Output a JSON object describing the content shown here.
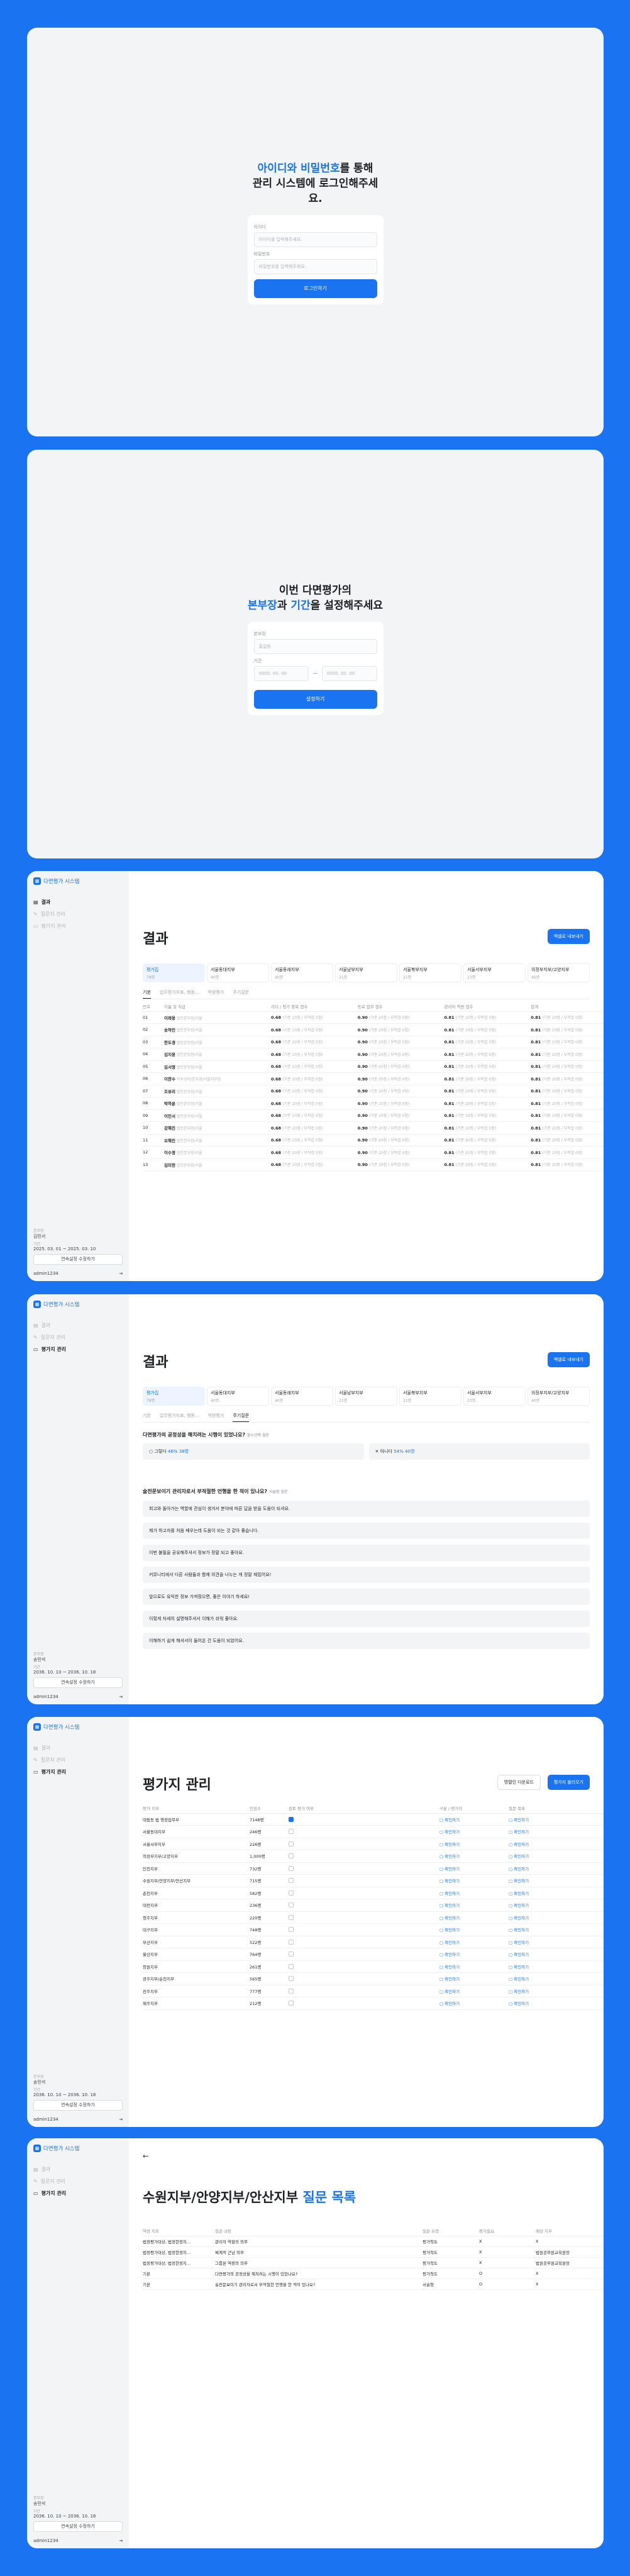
{
  "login": {
    "hero_a": "아이디와 ",
    "hero_b": "비밀번호",
    "hero_c": "를 통해",
    "hero_d": "관리 시스템에 로그인해주세요.",
    "id_label": "아이디",
    "id_placeholder": "아이디를 입력해주세요.",
    "pw_label": "비밀번호",
    "pw_placeholder": "비밀번호를 입력해주세요.",
    "button": "로그인하기"
  },
  "setup": {
    "hero_a": "이번 다면평가의",
    "hero_b": "본부장",
    "hero_c": "과 ",
    "hero_d": "기간",
    "hero_e": "을 설정해주세요",
    "name_label": "본부장",
    "name_placeholder": "홍길동",
    "period_label": "기간",
    "start_placeholder": "0000. 00. 00",
    "tilde": "~",
    "end_placeholder": "0000. 00. 00",
    "button": "설정하기"
  },
  "sidebar": {
    "brand": "다면평가 시스템",
    "nav": [
      "결과",
      "질문지 관리",
      "평가지 관리"
    ],
    "head_label": "본부장",
    "period_label": "기간",
    "button": "연속설정 수정하기",
    "user": "admin1234",
    "p3": {
      "head": "김민서",
      "period": "2025. 03. 01 ~ 2025. 03. 10"
    },
    "p4": {
      "head": "송민석",
      "period": "2036. 10. 10 ~ 2036. 10. 18"
    },
    "p5": {
      "head": "송민석",
      "period": "2036. 10. 10 ~ 2036. 10. 18"
    },
    "p6": {
      "head": "송민석",
      "period": "2036. 10. 10 ~ 2036. 10. 18"
    }
  },
  "result": {
    "title": "결과",
    "download": "엑셀로 내보내기",
    "tabs": [
      {
        "name": "평가집",
        "count": "78명"
      },
      {
        "name": "서울동대지부",
        "count": "40명"
      },
      {
        "name": "서울동래지부",
        "count": "40명"
      },
      {
        "name": "서울남부지부",
        "count": "21명"
      },
      {
        "name": "서울북부지부",
        "count": "21명"
      },
      {
        "name": "서울서부지부",
        "count": "23명"
      },
      {
        "name": "의정부지부/고양지부",
        "count": "40명"
      }
    ],
    "subtabs": [
      "기본",
      "업무평가지표, 행동...",
      "역량평가",
      "주기질문"
    ],
    "headers": [
      "번호",
      "이름 및 직급",
      "리더 / 평가 항목 점수",
      "동료 업무 점수",
      "관리자 역량 점수",
      "합계"
    ],
    "sub_a": "(기준 20점 / 부적합 0점)",
    "sub_b": "(기준 20점 / 부적합 0점)",
    "sub_c": "(기준 20점 / 부적합 0점)",
    "sub_d": "(기준 20점 / 부적합 0점)",
    "rows": [
      {
        "no": "01",
        "name": "이래웅",
        "role": "법인본부장/서울",
        "s1": "0.68",
        "s2": "0.90",
        "s3": "0.81",
        "s4": "0.81"
      },
      {
        "no": "02",
        "name": "송하민",
        "role": "법인본부장/서울",
        "s1": "0.68",
        "s2": "0.90",
        "s3": "0.81",
        "s4": "0.81"
      },
      {
        "no": "03",
        "name": "한도경",
        "role": "법인본부장/서울",
        "s1": "0.68",
        "s2": "0.90",
        "s3": "0.81",
        "s4": "0.81"
      },
      {
        "no": "04",
        "name": "김지웅",
        "role": "법인본부장/서울",
        "s1": "0.68",
        "s2": "0.90",
        "s3": "0.81",
        "s4": "0.81"
      },
      {
        "no": "05",
        "name": "김서영",
        "role": "법인본부장/서울",
        "s1": "0.68",
        "s2": "0.90",
        "s3": "0.81",
        "s4": "0.81"
      },
      {
        "no": "06",
        "name": "이한수",
        "role": "직속상사/본부장/서울지부장",
        "s1": "0.68",
        "s2": "0.90",
        "s3": "0.81",
        "s4": "0.81"
      },
      {
        "no": "07",
        "name": "조유리",
        "role": "법인본부장/서울",
        "s1": "0.68",
        "s2": "0.90",
        "s3": "0.81",
        "s4": "0.81"
      },
      {
        "no": "08",
        "name": "박하윤",
        "role": "법인본부장/서울",
        "s1": "0.68",
        "s2": "0.90",
        "s3": "0.81",
        "s4": "0.81"
      },
      {
        "no": "09",
        "name": "이민서",
        "role": "법인본부장/서울",
        "s1": "0.68",
        "s2": "0.90",
        "s3": "0.81",
        "s4": "0.81"
      },
      {
        "no": "10",
        "name": "강해진",
        "role": "법인본부장/서울",
        "s1": "0.68",
        "s2": "0.90",
        "s3": "0.81",
        "s4": "0.81"
      },
      {
        "no": "11",
        "name": "오해진",
        "role": "법인본부장/서울",
        "s1": "0.68",
        "s2": "0.90",
        "s3": "0.81",
        "s4": "0.81"
      },
      {
        "no": "12",
        "name": "이수정",
        "role": "법인본부장/서울",
        "s1": "0.68",
        "s2": "0.90",
        "s3": "0.81",
        "s4": "0.81"
      },
      {
        "no": "13",
        "name": "김미현",
        "role": "법인본부장/서울",
        "s1": "0.68",
        "s2": "0.90",
        "s3": "0.81",
        "s4": "0.81"
      }
    ]
  },
  "result2": {
    "question": "다면평가의 공정성을 해치려는 시행이 있었나요?",
    "question_note": "필수선택 질문",
    "yes": "그렇다",
    "yes_pct": "46% 38명",
    "no": "아니다",
    "no_pct": "54% 40명",
    "question2": "술전문보이기 관리자로서 부적절한 언행을 한 적이 있나요?",
    "question2_note": "서술형 질문",
    "answers": [
      "회고와 돌아가는 역할에 관심이 생겨서 분야에 따른 답을 받을 도움이 되셔요.",
      "제가 하고자를 처음 배우는데 도움이 되는 것 같아 좋습니다.",
      "이번 불필을 공유해주셔서 정보가 정말 되고 좋아요.",
      "커뮤니티에서 다른 사람들과 함께 의견을 나누는 게 정말 재밌어요!",
      "앞으로도 유익한 정보 가져줬으면, 좋은 이야기 하세요!",
      "이렇게 자세히 설명해주셔서 이해가 쉬워 좋아요.",
      "이해하기 쉽게 해셔서이 들어온 건 도움이 되었어요."
    ]
  },
  "eval": {
    "title": "평가지 관리",
    "btn_upload": "명렬인 다운로드",
    "btn_edit": "평가지 불러오기",
    "headers": [
      "평가 지부",
      "인원수",
      "검토 평가 여부",
      "구분 / 평가지",
      "질문 목록"
    ],
    "link_a": "확인하기",
    "link_b": "확인하기",
    "rows": [
      {
        "name": "대림동 법 행정업무부",
        "count": "7148명",
        "check": true
      },
      {
        "name": "서울동대지부",
        "count": "246명",
        "check": false
      },
      {
        "name": "서울서부지부",
        "count": "226명",
        "check": false
      },
      {
        "name": "의정부지부/고양지부",
        "count": "1,000명",
        "check": false
      },
      {
        "name": "인천지부",
        "count": "732명",
        "check": false
      },
      {
        "name": "수원지부/안양지부/안산지부",
        "count": "715명",
        "check": false
      },
      {
        "name": "춘천지부",
        "count": "582명",
        "check": false
      },
      {
        "name": "대전지부",
        "count": "236명",
        "check": false
      },
      {
        "name": "청주지부",
        "count": "220명",
        "check": false
      },
      {
        "name": "대구지부",
        "count": "748명",
        "check": false
      },
      {
        "name": "부산지부",
        "count": "522명",
        "check": false
      },
      {
        "name": "울산지부",
        "count": "764명",
        "check": false
      },
      {
        "name": "창원지부",
        "count": "261명",
        "check": false
      },
      {
        "name": "광주지부/순천지부",
        "count": "565명",
        "check": false
      },
      {
        "name": "전주지부",
        "count": "777명",
        "check": false
      },
      {
        "name": "제주지부",
        "count": "212명",
        "check": false
      }
    ]
  },
  "questions": {
    "back": "←",
    "title_a": "수원지부/안양지부/안산지부 ",
    "title_b": "질문 목록",
    "headers": [
      "역량 지표",
      "질문 내용",
      "질문 유형",
      "평가필요",
      "해당 지부"
    ],
    "rows": [
      {
        "cat": "법정평가대상, 법정한정지...",
        "q": "관리자 역할의 의무",
        "type": "평가척도",
        "req": "X",
        "dept": "X"
      },
      {
        "cat": "법정평가대상, 법정한정지...",
        "q": "체계적 근남 의무",
        "type": "평가척도",
        "req": "X",
        "dept": "법원공무원교육원장"
      },
      {
        "cat": "법정평가대상, 법정한정지...",
        "q": "그룹본 역량의 의무",
        "type": "평가척도",
        "req": "X",
        "dept": "법원공무원교육원장"
      },
      {
        "cat": "기본",
        "q": "다면평가의 공정성을 해치려는 시행이 있었나요?",
        "type": "평가척도",
        "req": "O",
        "dept": "X"
      },
      {
        "cat": "기본",
        "q": "술전문보이기 관리자로서 부적절한 언행을 한 적이 있나요?",
        "type": "서술형",
        "req": "O",
        "dept": "X"
      }
    ]
  },
  "colors": {
    "accent": "#1a73f0",
    "background": "#1a73f0",
    "panel": "#f3f4f6"
  },
  "icons": [
    "grid-icon",
    "chart-icon",
    "edit-icon",
    "folder-icon",
    "logout-icon",
    "check-icon",
    "arrow-left-icon",
    "file-icon"
  ]
}
